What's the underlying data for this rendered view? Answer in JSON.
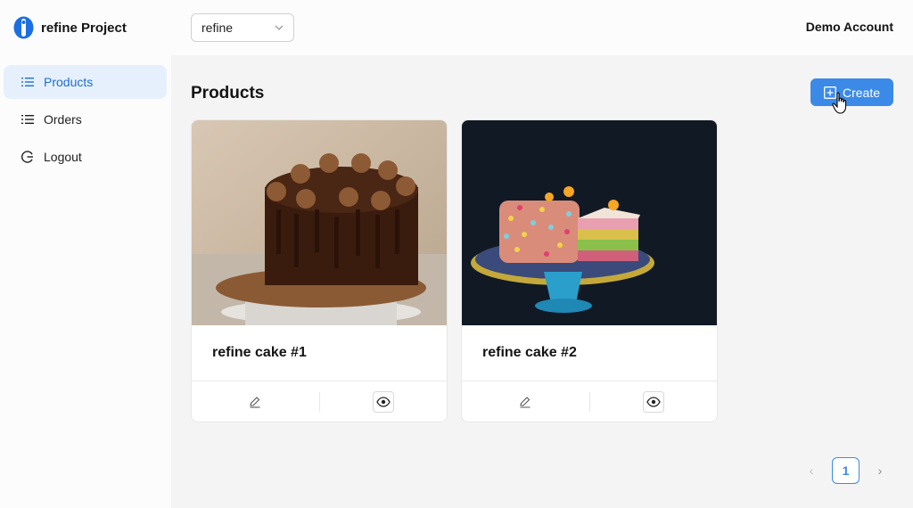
{
  "header": {
    "logo_text": "refine Project",
    "select_value": "refine",
    "account": "Demo Account"
  },
  "sidebar": {
    "items": [
      {
        "label": "Products",
        "icon": "list-icon",
        "active": true
      },
      {
        "label": "Orders",
        "icon": "list-icon",
        "active": false
      },
      {
        "label": "Logout",
        "icon": "logout-icon",
        "active": false
      }
    ]
  },
  "main": {
    "title": "Products",
    "create_label": "Create",
    "cards": [
      {
        "name": "refine cake #1",
        "image": "chocolate-cake-photo"
      },
      {
        "name": "refine cake #2",
        "image": "sprinkle-cake-slice-photo"
      }
    ],
    "pagination": {
      "prev": "‹",
      "current": "1",
      "next": "›"
    }
  },
  "colors": {
    "accent": "#3b8ae8",
    "active_bg": "#e6f0fc",
    "active_text": "#1d6fd3"
  }
}
